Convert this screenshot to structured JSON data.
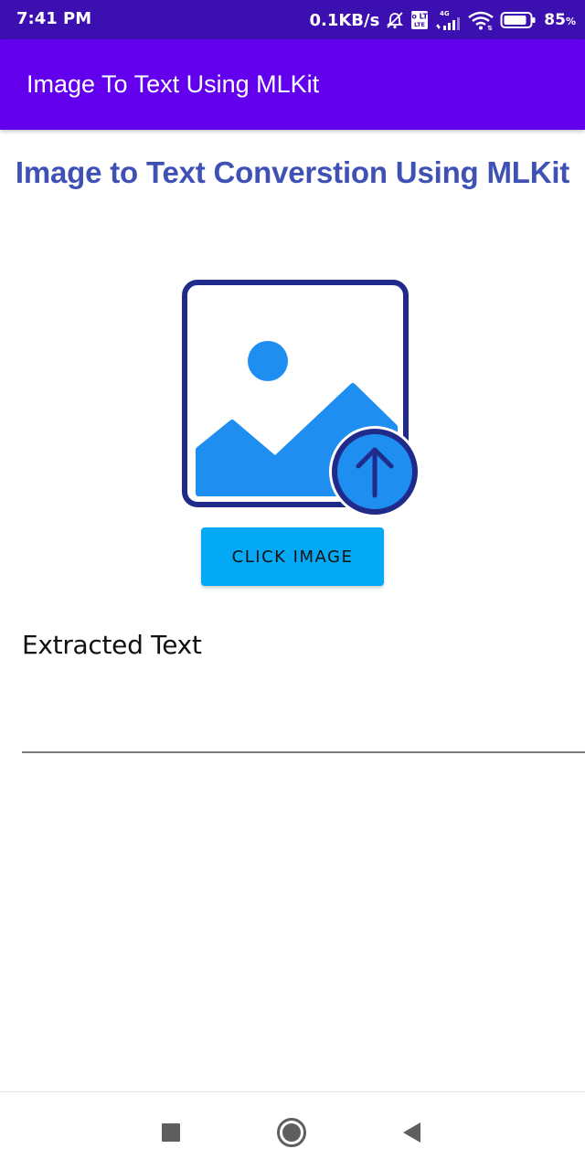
{
  "status_bar": {
    "time": "7:41 PM",
    "network_speed": "0.1KB/s",
    "volte_label": "Vo LTE",
    "network_type": "4G",
    "battery_level": "85",
    "battery_unit": "%",
    "icons": [
      "alarm-off-icon",
      "volte-icon",
      "cellular-signal-icon",
      "wifi-icon",
      "battery-icon"
    ]
  },
  "app_bar": {
    "title": "Image To Text Using MLKit",
    "color": "#6200ee"
  },
  "main": {
    "heading": "Image to Text Converstion Using MLKit",
    "heading_color": "#3f51b5",
    "image_icon": "image-upload-icon",
    "click_button_label": "CLICK IMAGE",
    "button_color": "#03a9f4",
    "extracted_label": "Extracted Text",
    "extracted_value": ""
  },
  "nav_bar": {
    "icons": [
      "recents-square-icon",
      "home-circle-icon",
      "back-triangle-icon"
    ]
  }
}
